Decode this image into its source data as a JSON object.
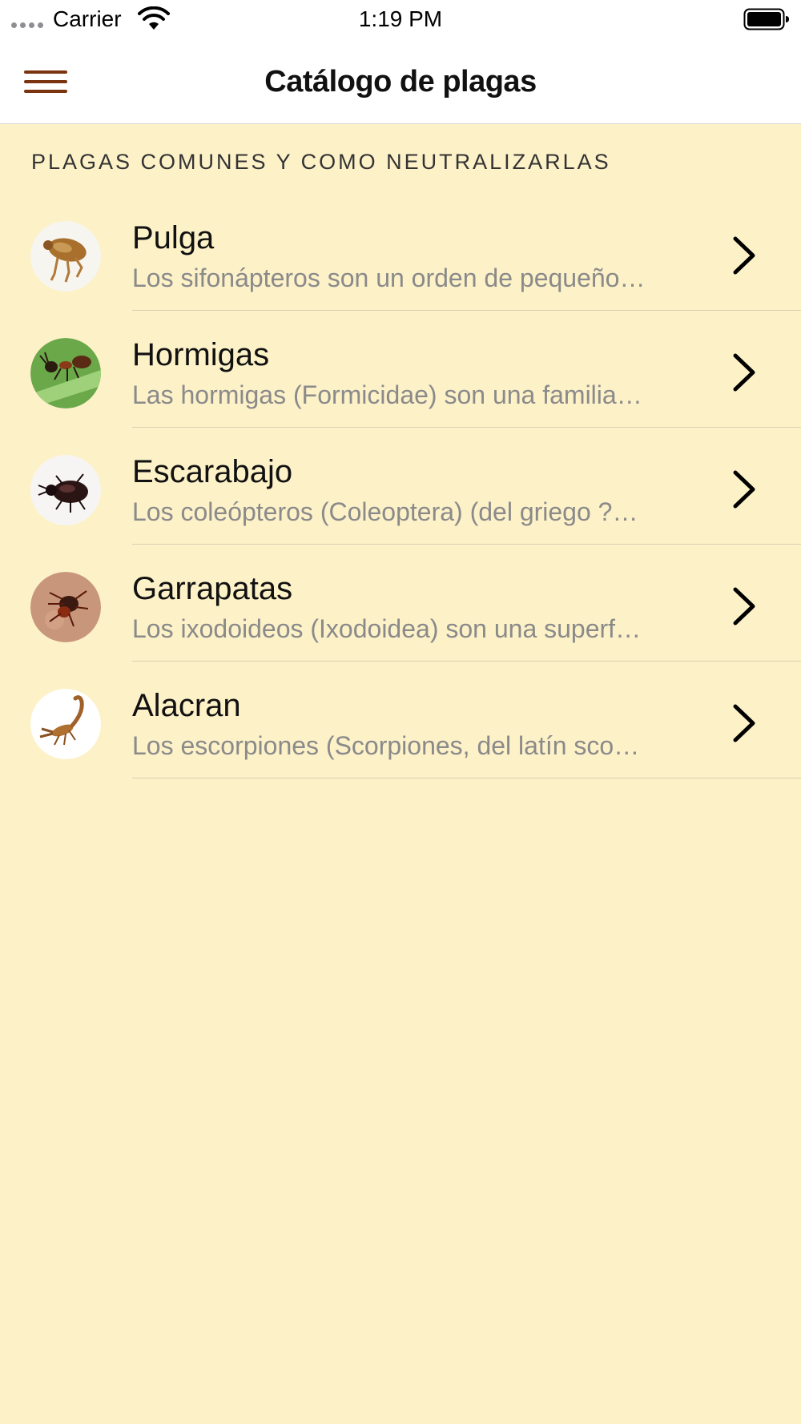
{
  "status_bar": {
    "carrier": "Carrier",
    "time": "1:19 PM"
  },
  "nav": {
    "title": "Catálogo de plagas",
    "menu_icon": "hamburger-menu-icon",
    "accent_color": "#7a3510"
  },
  "section": {
    "header": "PLAGAS COMUNES Y COMO NEUTRALIZARLAS"
  },
  "pests": [
    {
      "title": "Pulga",
      "subtitle": "Los sifonápteros son un orden de pequeño…",
      "icon": "flea-icon"
    },
    {
      "title": "Hormigas",
      "subtitle": "Las hormigas (Formicidae) son una familia…",
      "icon": "ant-icon"
    },
    {
      "title": "Escarabajo",
      "subtitle": "Los coleópteros (Coleoptera) (del griego ?…",
      "icon": "beetle-icon"
    },
    {
      "title": "Garrapatas",
      "subtitle": "Los ixodoideos (Ixodoidea) son una superf…",
      "icon": "tick-icon"
    },
    {
      "title": "Alacran",
      "subtitle": "Los escorpiones (Scorpiones, del latín sco…",
      "icon": "scorpion-icon"
    }
  ],
  "colors": {
    "background": "#fdf1c8",
    "nav_background": "#ffffff",
    "subtitle_text": "#8a8a8a"
  }
}
